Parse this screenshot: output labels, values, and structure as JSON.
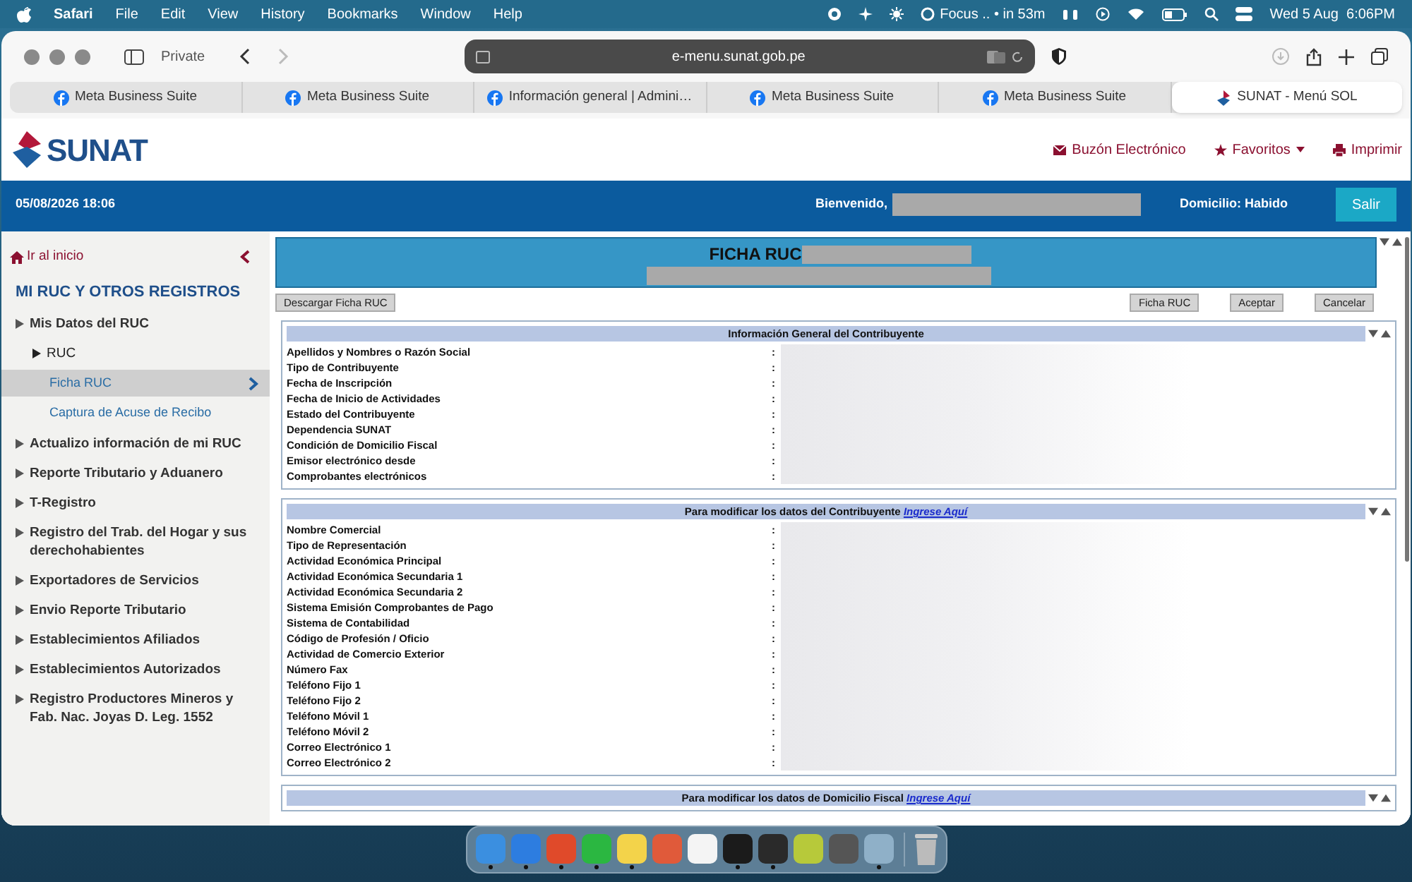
{
  "menubar": {
    "app": "Safari",
    "menus": [
      "File",
      "Edit",
      "View",
      "History",
      "Bookmarks",
      "Window",
      "Help"
    ],
    "focus": "Focus .. • in 53m",
    "clock": "Wed 5 Aug  6:06PM"
  },
  "browser": {
    "private_label": "Private",
    "url": "e-menu.sunat.gob.pe",
    "tabs": [
      {
        "title": "Meta Business Suite",
        "kind": "meta",
        "selected": false
      },
      {
        "title": "Meta Business Suite",
        "kind": "meta",
        "selected": false
      },
      {
        "title": "Información general | Admini…",
        "kind": "meta",
        "selected": false
      },
      {
        "title": "Meta Business Suite",
        "kind": "meta",
        "selected": false
      },
      {
        "title": "Meta Business Suite",
        "kind": "meta",
        "selected": false
      },
      {
        "title": "SUNAT - Menú SOL",
        "kind": "sunat",
        "selected": true
      }
    ]
  },
  "site": {
    "logo": "SUNAT",
    "links": [
      {
        "label": "Buzón Electrónico",
        "kind": "mail"
      },
      {
        "label": "Favoritos",
        "kind": "star"
      },
      {
        "label": "Imprimir",
        "kind": "print"
      }
    ],
    "datetime": "05/08/2026 18:06",
    "welcome": "Bienvenido,",
    "domicilio": "Domicilio: Habido",
    "logout": "Salir"
  },
  "sidebar": {
    "home": "Ir al inicio",
    "heading": "MI RUC Y OTROS REGISTROS",
    "items": [
      {
        "label": "Mis Datos del RUC",
        "children": [
          {
            "label": "RUC",
            "children": [
              {
                "label": "Ficha RUC",
                "selected": true
              },
              {
                "label": "Captura de Acuse de Recibo",
                "selected": false
              }
            ]
          }
        ]
      },
      {
        "label": "Actualizo información de mi RUC"
      },
      {
        "label": "Reporte Tributario y Aduanero"
      },
      {
        "label": "T-Registro"
      },
      {
        "label": "Registro del Trab. del Hogar y sus derechohabientes"
      },
      {
        "label": "Exportadores de Servicios"
      },
      {
        "label": "Envio Reporte Tributario"
      },
      {
        "label": "Establecimientos Afiliados"
      },
      {
        "label": "Establecimientos Autorizados"
      },
      {
        "label": "Registro Productores Mineros y Fab. Nac. Joyas D. Leg. 1552"
      }
    ]
  },
  "main": {
    "title": "FICHA RUC",
    "buttons_left": [
      "Descargar Ficha RUC"
    ],
    "buttons_right": [
      "Ficha RUC",
      "Aceptar",
      "Cancelar"
    ],
    "separator": ":",
    "sections": [
      {
        "heading": "Información General del Contribuyente",
        "fields": [
          "Apellidos y Nombres o Razón Social",
          "Tipo de Contribuyente",
          "Fecha de Inscripción",
          "Fecha de Inicio de Actividades",
          "Estado del Contribuyente",
          "Dependencia SUNAT",
          "Condición de Domicilio Fiscal",
          "Emisor electrónico desde",
          "Comprobantes electrónicos"
        ]
      },
      {
        "heading": "Para modificar los datos del Contribuyente",
        "link": "Ingrese Aquí",
        "fields": [
          "Nombre Comercial",
          "Tipo de Representación",
          "Actividad Económica Principal",
          "Actividad Económica Secundaria 1",
          "Actividad Económica Secundaria 2",
          "Sistema Emisión Comprobantes de Pago",
          "Sistema de Contabilidad",
          "Código de Profesión / Oficio",
          "Actividad de Comercio Exterior",
          "Número Fax",
          "Teléfono Fijo 1",
          "Teléfono Fijo 2",
          "Teléfono Móvil 1",
          "Teléfono Móvil 2",
          "Correo Electrónico 1",
          "Correo Electrónico 2"
        ]
      },
      {
        "heading": "Para modificar los datos de Domicilio Fiscal",
        "link": "Ingrese Aquí"
      }
    ]
  },
  "dock": {
    "apps": [
      {
        "color": "#3b8fe0",
        "running": true
      },
      {
        "color": "#2d7de0",
        "running": true
      },
      {
        "color": "#e04a2a",
        "running": true
      },
      {
        "color": "#2bb741",
        "running": true
      },
      {
        "color": "#f3d34a",
        "running": true
      },
      {
        "color": "#e05a3a",
        "running": false
      },
      {
        "color": "#f4f4f4",
        "running": false
      },
      {
        "color": "#1b1b1b",
        "running": true
      },
      {
        "color": "#2a2a2a",
        "running": true
      },
      {
        "color": "#b7c93a",
        "running": false
      },
      {
        "color": "#555555",
        "running": false
      },
      {
        "color": "#8fb0c8",
        "running": true
      }
    ]
  }
}
